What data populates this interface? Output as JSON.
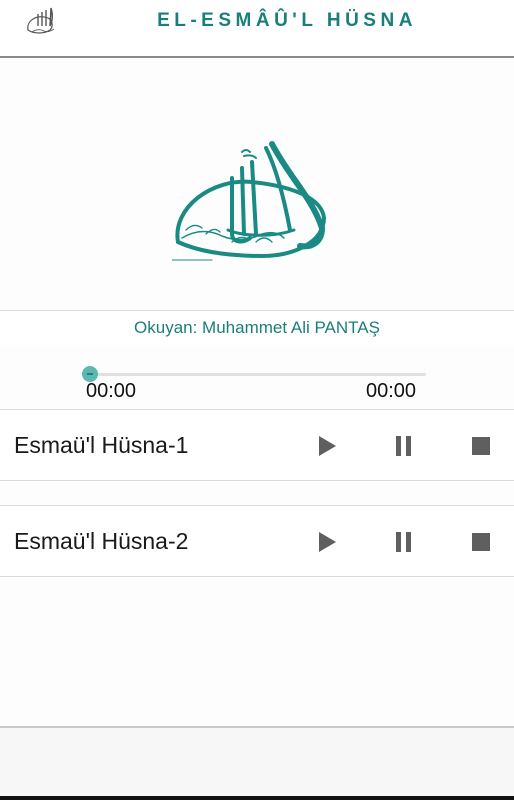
{
  "header": {
    "title": "EL-ESMÂÛ'L HÜSNA",
    "logo_icon": "allah-calligraphy-icon"
  },
  "hero": {
    "image": "allah-calligraphy-image",
    "color": "#1a7f7a"
  },
  "reader": {
    "label": "Okuyan: Muhammet Ali PANTAŞ"
  },
  "player": {
    "current_time": "00:00",
    "total_time": "00:00",
    "progress": 0,
    "accent": "#3aa79f"
  },
  "tracks": [
    {
      "title": "Esmaü'l Hüsna-1",
      "controls": [
        "play-icon",
        "pause-icon",
        "stop-icon"
      ]
    },
    {
      "title": "Esmaü'l Hüsna-2",
      "controls": [
        "play-icon",
        "pause-icon",
        "stop-icon"
      ]
    }
  ]
}
